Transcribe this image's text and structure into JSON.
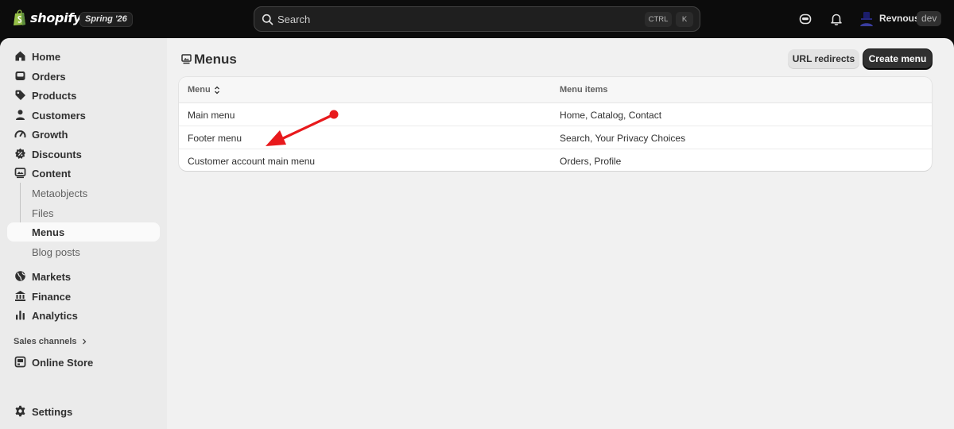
{
  "topbar": {
    "logo_text": "shopify",
    "edition": "Spring '26",
    "search_placeholder": "Search",
    "shortcut_modifier": "CTRL",
    "shortcut_key": "K",
    "user_name": "Revnous",
    "user_badge": "dev"
  },
  "sidebar": {
    "items": [
      {
        "label": "Home",
        "icon": "home-icon"
      },
      {
        "label": "Orders",
        "icon": "inbox-icon"
      },
      {
        "label": "Products",
        "icon": "tag-icon"
      },
      {
        "label": "Customers",
        "icon": "person-icon"
      },
      {
        "label": "Growth",
        "icon": "gauge-icon"
      },
      {
        "label": "Discounts",
        "icon": "discount-icon"
      },
      {
        "label": "Content",
        "icon": "content-icon"
      }
    ],
    "content_sub": [
      "Metaobjects",
      "Files",
      "Menus",
      "Blog posts"
    ],
    "items2": [
      {
        "label": "Markets",
        "icon": "globe-icon"
      },
      {
        "label": "Finance",
        "icon": "bank-icon"
      },
      {
        "label": "Analytics",
        "icon": "bar-chart-icon"
      }
    ],
    "sales_channels_label": "Sales channels",
    "online_store_label": "Online Store",
    "settings_label": "Settings"
  },
  "page": {
    "title": "Menus",
    "url_redirects_label": "URL redirects",
    "create_menu_label": "Create menu"
  },
  "table": {
    "columns": [
      "Menu",
      "Menu items"
    ],
    "rows": [
      {
        "menu": "Main menu",
        "items": "Home, Catalog, Contact"
      },
      {
        "menu": "Footer menu",
        "items": "Search, Your Privacy Choices"
      },
      {
        "menu": "Customer account main menu",
        "items": "Orders, Profile"
      }
    ]
  },
  "colors": {
    "annotation_arrow": "#e8191c",
    "primary_button": "#303030",
    "topbar": "#0c0c0c"
  }
}
